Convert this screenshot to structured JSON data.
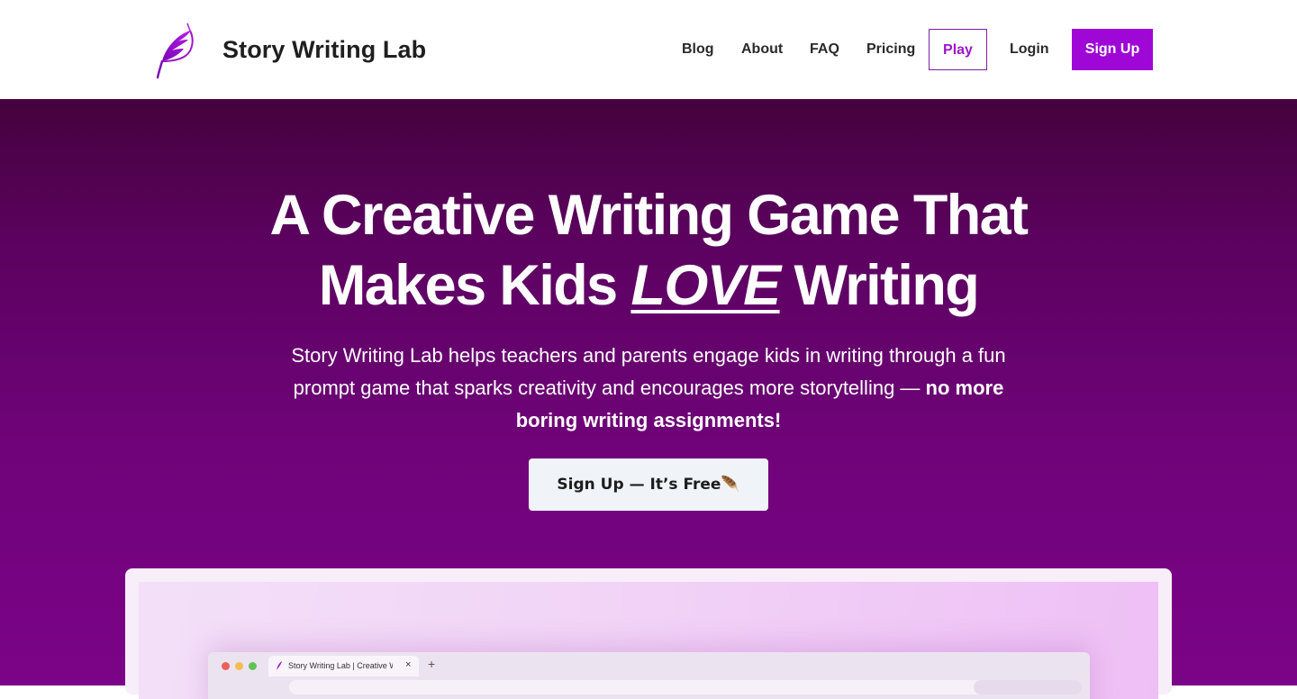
{
  "header": {
    "brand_name": "Story Writing Lab",
    "logo_icon": "quill-feather-icon",
    "nav": [
      {
        "label": "Blog"
      },
      {
        "label": "About"
      },
      {
        "label": "FAQ"
      },
      {
        "label": "Pricing"
      },
      {
        "label": "Play"
      },
      {
        "label": "Login"
      },
      {
        "label": "Sign Up"
      }
    ]
  },
  "hero": {
    "title_line1": "A Creative Writing Game That",
    "title_line2_before": "Makes Kids ",
    "title_line2_emphasis": "LOVE",
    "title_line2_after": " Writing",
    "subtitle_plain": "Story Writing Lab helps teachers and parents engage kids in writing through a fun prompt game that sparks creativity and encourages more storytelling — ",
    "subtitle_bold": "no more boring writing assignments!",
    "cta_label": "Sign Up — It’s Free🪶"
  },
  "preview": {
    "tab_title": "Story Writing Lab | Creative Writing",
    "tab_close": "×",
    "new_tab": "+"
  },
  "colors": {
    "accent": "#9f07d6",
    "hero_top": "#45023d",
    "hero_bottom": "#7b0387",
    "cta_bg": "#f0f3f7"
  }
}
